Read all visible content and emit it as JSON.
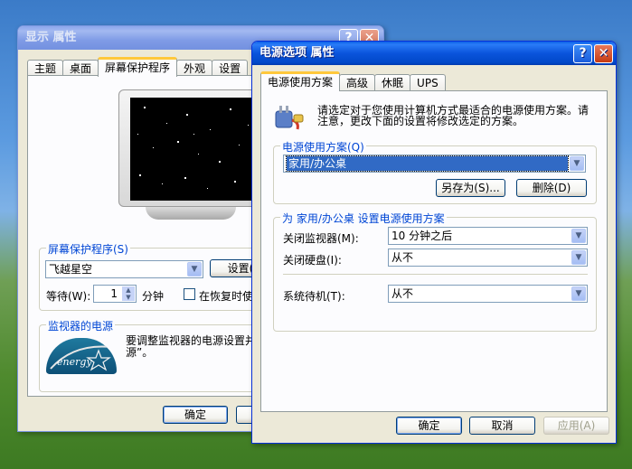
{
  "display_window": {
    "title": "显示 属性",
    "tabs": [
      "主题",
      "桌面",
      "屏幕保护程序",
      "外观",
      "设置"
    ],
    "screensaver_label": "屏幕保护程序(S)",
    "screensaver_value": "飞越星空",
    "settings_button": "设置(T)",
    "wait_label": "等待(W):",
    "wait_value": "1",
    "wait_unit": "分钟",
    "resume_label": "在恢复时使",
    "monitor_power_label": "监视器的电源",
    "monitor_power_text_1": "要调整监视器的电源设置并",
    "monitor_power_text_2": "源”。",
    "energy_logo_text": "energy",
    "ok_button": "确定",
    "help_btn": "?",
    "close_btn": "✕"
  },
  "power_window": {
    "title": "电源选项 属性",
    "help_btn": "?",
    "close_btn": "✕",
    "tabs": [
      "电源使用方案",
      "高级",
      "休眠",
      "UPS"
    ],
    "intro_line1": "请选定对于您使用计算机方式最适合的电源使用方案。请",
    "intro_line2": "注意，更改下面的设置将修改选定的方案。",
    "scheme_group": "电源使用方案(Q)",
    "scheme_value": "家用/办公桌",
    "save_as_button": "另存为(S)...",
    "delete_button": "删除(D)",
    "settings_group": "为 家用/办公桌 设置电源使用方案",
    "monitor_label": "关闭监视器(M):",
    "monitor_value": "10 分钟之后",
    "disk_label": "关闭硬盘(I):",
    "disk_value": "从不",
    "standby_label": "系统待机(T):",
    "standby_value": "从不",
    "ok_button": "确定",
    "cancel_button": "取消",
    "apply_button": "应用(A)"
  }
}
